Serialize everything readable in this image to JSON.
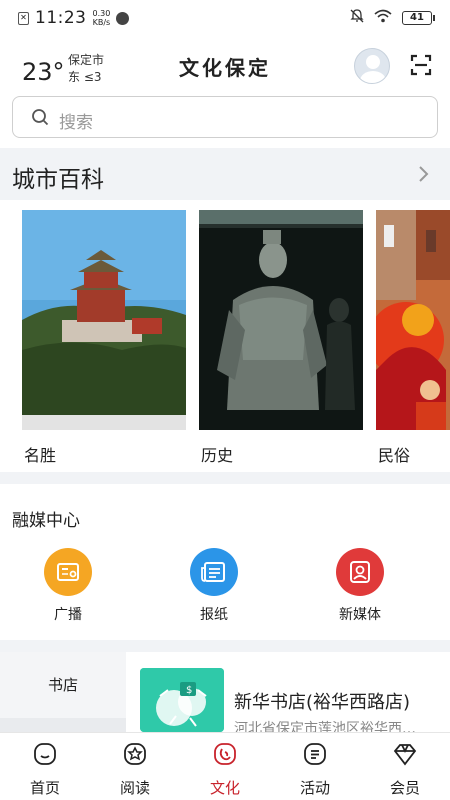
{
  "status_bar": {
    "time": "11:23",
    "net_speed_value": "0.30",
    "net_speed_unit": "KB/s",
    "battery": "41"
  },
  "header": {
    "temperature": "23°",
    "city": "保定市",
    "wind": "东  ≤3",
    "app_title": "文化保定"
  },
  "search": {
    "placeholder": "搜索"
  },
  "encyclopedia": {
    "title": "城市百科",
    "cards": [
      {
        "label": "名胜",
        "icon": "pagoda-photo"
      },
      {
        "label": "历史",
        "icon": "terracotta-warrior-photo"
      },
      {
        "label": "民俗",
        "icon": "dragon-dance-photo"
      }
    ]
  },
  "media_center": {
    "title": "融媒中心",
    "items": [
      {
        "label": "广播",
        "icon": "radio-icon",
        "color": "#f5a623"
      },
      {
        "label": "报纸",
        "icon": "newspaper-icon",
        "color": "#2b95e8"
      },
      {
        "label": "新媒体",
        "icon": "new-media-icon",
        "color": "#e03a3a"
      }
    ]
  },
  "store": {
    "tab": "书店",
    "name": "新华书店(裕华西路店)",
    "address": "河北省保定市莲池区裕华西…"
  },
  "nav": {
    "items": [
      {
        "label": "首页",
        "icon": "home-icon"
      },
      {
        "label": "阅读",
        "icon": "reading-icon"
      },
      {
        "label": "文化",
        "icon": "culture-icon",
        "active": true
      },
      {
        "label": "活动",
        "icon": "activity-icon"
      },
      {
        "label": "会员",
        "icon": "member-icon"
      }
    ],
    "active_color": "#c8232c"
  }
}
